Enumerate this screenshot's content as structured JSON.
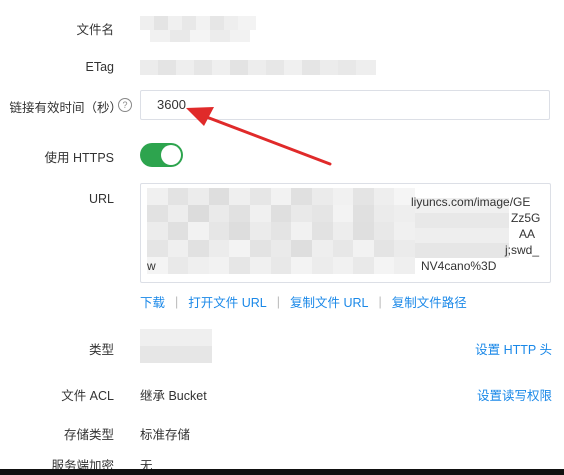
{
  "labels": {
    "filename": "文件名",
    "etag": "ETag",
    "expiry": "链接有效时间（秒）",
    "https": "使用 HTTPS",
    "url": "URL",
    "type": "类型",
    "acl": "文件 ACL",
    "storage": "存储类型",
    "encryption": "服务端加密"
  },
  "expiry_input_value": "3600",
  "help_icon_glyph": "?",
  "https_enabled": true,
  "url_fragments": {
    "line1": "liyuncs.com/image/GE",
    "line2": "Zz5G",
    "line3": "AA",
    "line4": "j;swd_",
    "line5": "NV4cano%3D",
    "line5_prefix": "w"
  },
  "url_actions": {
    "download": "下载",
    "open": "打开文件 URL",
    "copy_url": "复制文件 URL",
    "copy_path": "复制文件路径"
  },
  "set_http_header": "设置 HTTP 头",
  "set_acl": "设置读写权限",
  "acl_value": "继承 Bucket",
  "storage_value": "标准存储",
  "encryption_value": "无",
  "annotation_arrow_color": "#e02a2a",
  "link_color": "#1a88e8",
  "toggle_color": "#2da44e"
}
